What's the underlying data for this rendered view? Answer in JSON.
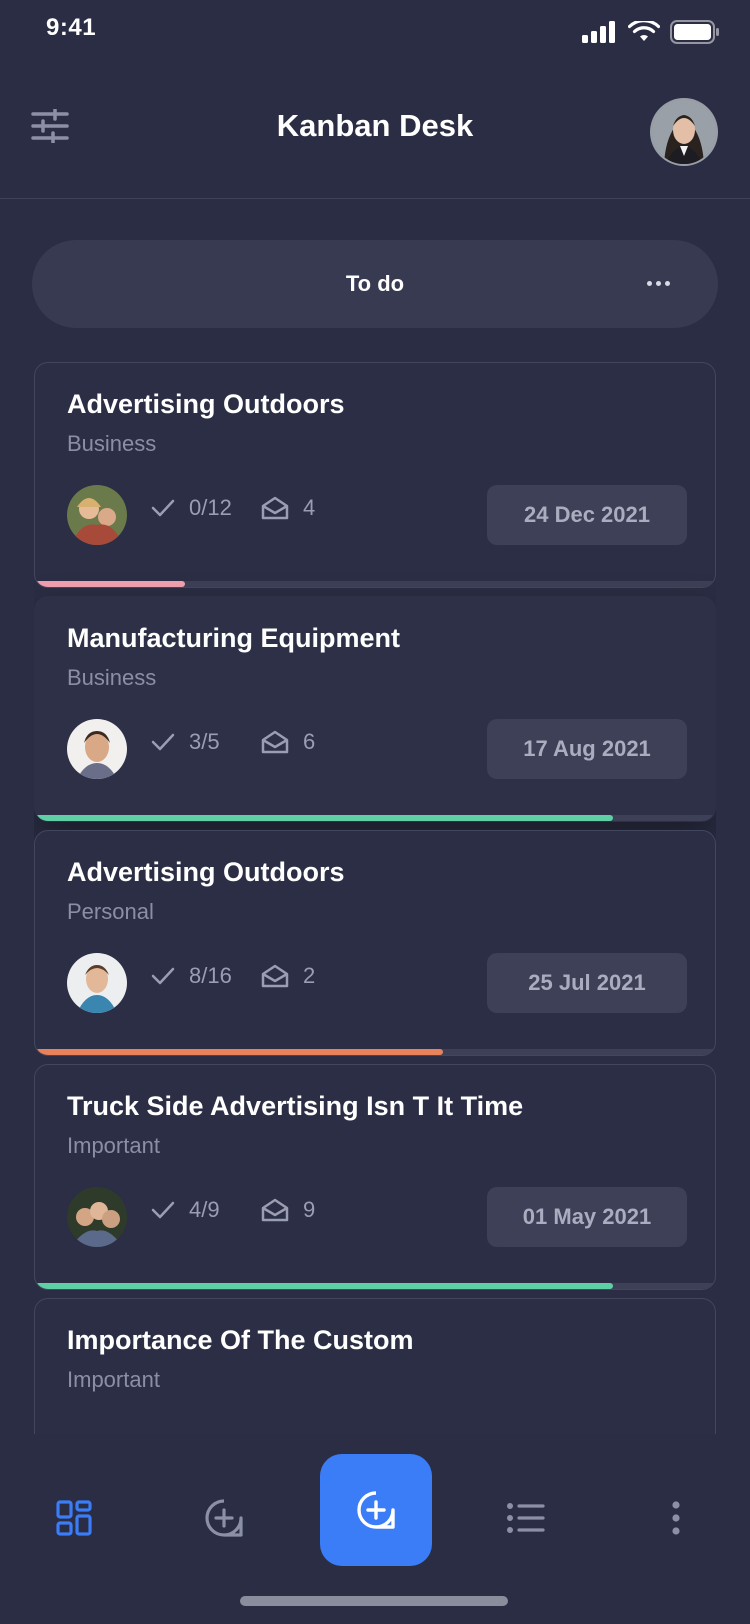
{
  "status_bar": {
    "time": "9:41"
  },
  "header": {
    "title": "Kanban Desk"
  },
  "column": {
    "title": "To do"
  },
  "cards": [
    {
      "title": "Advertising Outdoors",
      "category": "Business",
      "tasks": "0/12",
      "mails": "4",
      "date": "24 Dec 2021",
      "progress": 0.22,
      "progress_color": "#f2a0b0"
    },
    {
      "title": "Manufacturing Equipment",
      "category": "Business",
      "tasks": "3/5",
      "mails": "6",
      "date": "17 Aug 2021",
      "progress": 0.85,
      "progress_color": "#5fcfa6"
    },
    {
      "title": "Advertising Outdoors",
      "category": "Personal",
      "tasks": "8/16",
      "mails": "2",
      "date": "25 Jul 2021",
      "progress": 0.6,
      "progress_color": "#e8825a"
    },
    {
      "title": "Truck Side Advertising Isn T It Time",
      "category": "Important",
      "tasks": "4/9",
      "mails": "9",
      "date": "01 May 2021",
      "progress": 0.85,
      "progress_color": "#5fcfa6"
    },
    {
      "title": "Importance Of The Custom",
      "category": "Important",
      "tasks": "",
      "mails": "",
      "date": "",
      "progress": 0,
      "progress_color": "#5fcfa6"
    }
  ],
  "bottom_nav": {
    "items": [
      "board-icon",
      "add-circle-icon",
      "add-message-icon",
      "list-icon",
      "more-vertical-icon"
    ],
    "active": "board-icon",
    "accent": "#3b7df6"
  },
  "colors": {
    "background": "#2a2d43",
    "card_border": "#43475e",
    "accent": "#3b7df6"
  }
}
